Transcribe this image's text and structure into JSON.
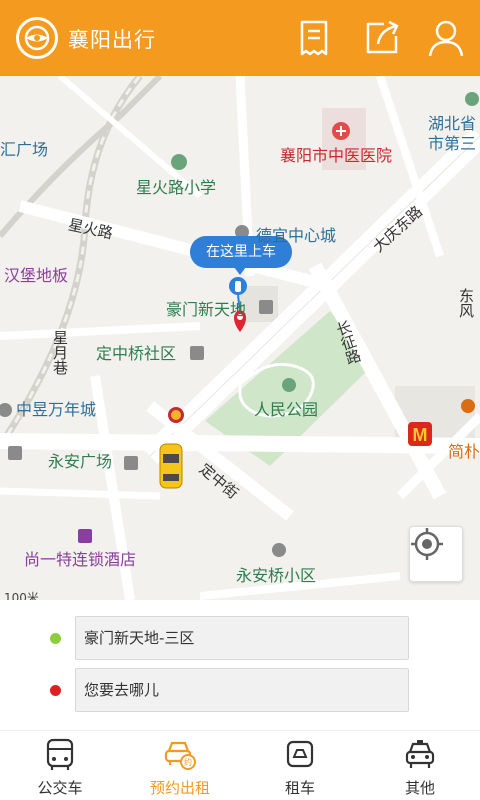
{
  "header": {
    "title": "襄阳出行",
    "bg_color": "#f39a1f"
  },
  "map": {
    "pickup_bubble": "在这里上车",
    "scale_partial": "100米",
    "labels": {
      "guangchang_left": "汇广场",
      "xiaoxue": "星火路小学",
      "zhongyi": "襄阳市中医医院",
      "hubei": "湖北省",
      "shi3": "市第三",
      "dejiahui": "德宜中心城",
      "xinghuolu": "星火路",
      "hanbao": "汉堡地板",
      "daqingdonglu": "大庆东路",
      "haomen": "豪门新天地",
      "dongfeng": "东风",
      "xingyuexiang": "星月巷",
      "dingzhongqiao": "定中桥社区",
      "changzhenglu": "长征路",
      "zhongyu": "中昱万年城",
      "renmingongyuan": "人民公园",
      "jianzhu": "简朴",
      "yonganguangchang": "永安广场",
      "dingzhongjie": "定中街",
      "shangyite": "尚一特连锁酒店",
      "yonganqiao": "永安桥小区"
    }
  },
  "panel": {
    "start": {
      "text": "豪门新天地-三区",
      "dot_color": "#8ccf3a"
    },
    "destination": {
      "placeholder": "您要去哪儿",
      "dot_color": "#e02020"
    }
  },
  "tabs": [
    {
      "label": "公交车",
      "icon": "bus-icon",
      "active": false
    },
    {
      "label": "预约出租",
      "icon": "taxi-booking-icon",
      "active": true
    },
    {
      "label": "租车",
      "icon": "rental-car-icon",
      "active": false
    },
    {
      "label": "其他",
      "icon": "car-icon",
      "active": false
    }
  ],
  "colors": {
    "accent": "#f39a1f",
    "pin_blue": "#2f7ed8",
    "pin_red": "#e02430",
    "park_green": "#cfe6c8"
  }
}
